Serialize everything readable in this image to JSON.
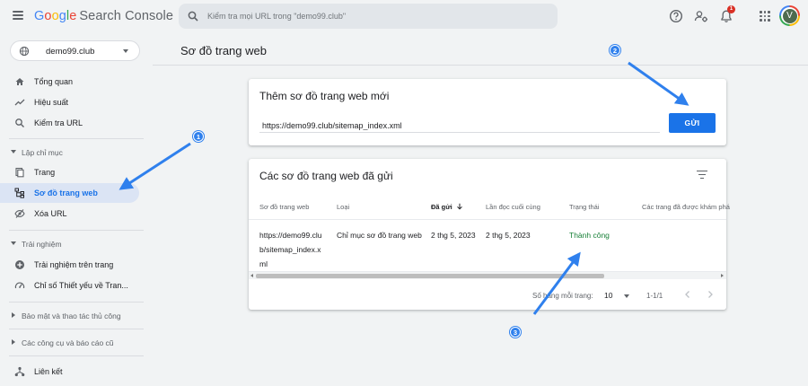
{
  "header": {
    "logo_parts": [
      "G",
      "o",
      "o",
      "g",
      "l",
      "e"
    ],
    "product": "Search Console",
    "search_placeholder": "Kiểm tra mọi URL trong \"demo99.club\"",
    "notification_count": "1",
    "avatar_letter": "V"
  },
  "sidebar": {
    "property": "demo99.club",
    "items_top": [
      {
        "label": "Tổng quan",
        "icon": "home-icon"
      },
      {
        "label": "Hiệu suất",
        "icon": "trending-up-icon"
      },
      {
        "label": "Kiểm tra URL",
        "icon": "search-icon"
      }
    ],
    "section_index": "Lập chỉ mục",
    "items_index": [
      {
        "label": "Trang",
        "icon": "page-icon"
      },
      {
        "label": "Sơ đồ trang web",
        "icon": "sitemap-icon"
      },
      {
        "label": "Xóa URL",
        "icon": "eye-off-icon"
      }
    ],
    "section_experience": "Trải nghiệm",
    "items_experience": [
      {
        "label": "Trải nghiệm trên trang",
        "icon": "plus-circle-icon"
      },
      {
        "label": "Chỉ số Thiết yếu về Tran...",
        "icon": "gauge-icon"
      }
    ],
    "section_security": "Bảo mật và thao tác thủ công",
    "section_tools": "Các công cụ và báo cáo cũ",
    "item_links": {
      "label": "Liên kết",
      "icon": "links-icon"
    }
  },
  "main": {
    "page_title": "Sơ đồ trang web",
    "add_card": {
      "title": "Thêm sơ đồ trang web mới",
      "input_value": "https://demo99.club/sitemap_index.xml",
      "submit_label": "GỬI"
    },
    "submitted_card": {
      "title": "Các sơ đồ trang web đã gửi",
      "columns": [
        "Sơ đồ trang web",
        "Loại",
        "Đã gửi",
        "Lần đọc cuối cùng",
        "Trạng thái",
        "Các trang đã được khám phá"
      ],
      "row": {
        "sitemap": [
          "https://demo99.clu",
          "b/sitemap_index.x",
          "ml"
        ],
        "type": "Chỉ mục sơ đồ trang web",
        "submitted": "2 thg 5, 2023",
        "last_read": "2 thg 5, 2023",
        "status": "Thành công"
      },
      "rows_per_page_label": "Số hàng mỗi trang:",
      "rows_per_page_value": "10",
      "range": "1-1/1"
    }
  },
  "annotations": [
    "1",
    "2",
    "3"
  ],
  "colors": {
    "accent": "#1a73e8",
    "success": "#188038",
    "annotation": "#2f80ed"
  }
}
